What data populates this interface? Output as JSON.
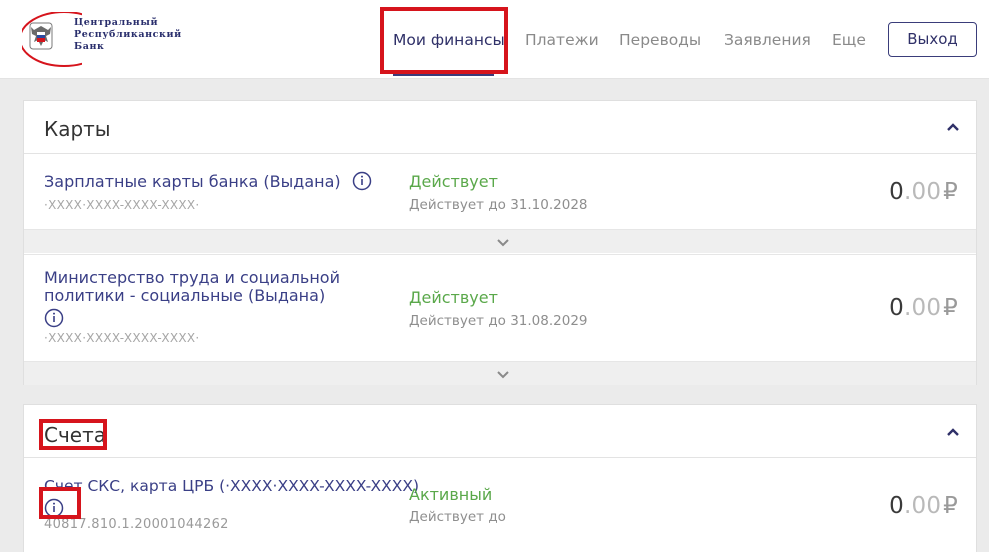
{
  "logo": {
    "line1": "Центральный",
    "line2": "Республиканский",
    "line3": "Банк"
  },
  "nav": {
    "items": [
      {
        "label": "Мои финансы",
        "active": true
      },
      {
        "label": "Платежи"
      },
      {
        "label": "Переводы"
      },
      {
        "label": "Заявления"
      },
      {
        "label": "Еще"
      }
    ],
    "logout_label": "Выход"
  },
  "cards": {
    "title": "Карты",
    "items": [
      {
        "name": "Зарплатные карты банка (Выдана)",
        "masked_number": "·XXXX·XXXX-XXXX-XXXX·",
        "status": "Действует",
        "valid_until": "Действует до 31.10.2028",
        "amount_int": "0",
        "amount_dec": ".00",
        "currency": "₽"
      },
      {
        "name_line1": "Министерство труда и социальной",
        "name_line2": "политики - социальные (Выдана)",
        "masked_number": "·XXXX·XXXX-XXXX-XXXX·",
        "status": "Действует",
        "valid_until": "Действует до 31.08.2029",
        "amount_int": "0",
        "amount_dec": ".00",
        "currency": "₽"
      }
    ]
  },
  "accounts": {
    "title": "Счета",
    "items": [
      {
        "name": "Счет СКС, карта ЦРБ (·XXXX·XXXX-XXXX-XXXX)",
        "account_number": "40817.810.1.20001044262",
        "status": "Активный",
        "valid_until": "Действует до",
        "amount_int": "0",
        "amount_dec": ".00",
        "currency": "₽"
      }
    ]
  },
  "colors": {
    "brand": "#2f3068",
    "status_green": "#5aa84a",
    "highlight_red": "#d6141c"
  },
  "icons": [
    "coat-of-arms-logo",
    "info-icon",
    "chevron-up-icon",
    "chevron-down-icon"
  ]
}
